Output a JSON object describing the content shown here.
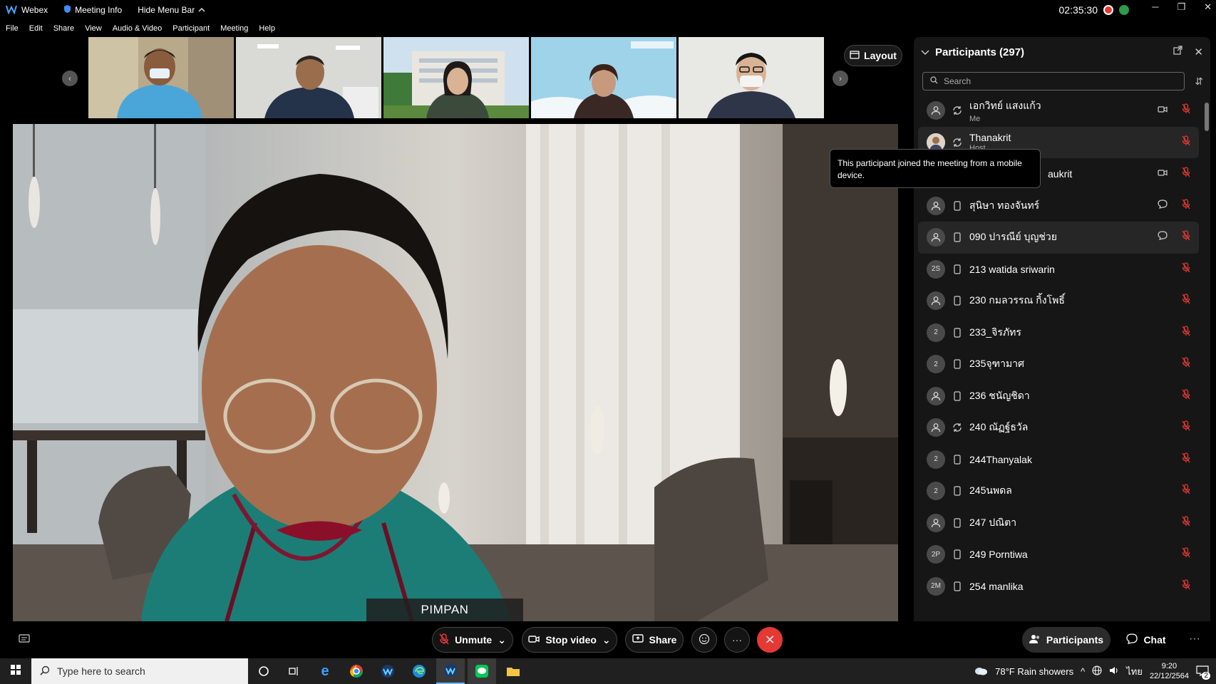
{
  "titlebar": {
    "app_name": "Webex",
    "meeting_info": "Meeting Info",
    "hide_menu": "Hide Menu Bar",
    "clock": "02:35:30"
  },
  "menu": [
    "File",
    "Edit",
    "Share",
    "View",
    "Audio & Video",
    "Participant",
    "Meeting",
    "Help"
  ],
  "layout_label": "Layout",
  "speaker_name": "PIMPAN",
  "panel": {
    "title": "Participants (297)",
    "search_placeholder": "Search"
  },
  "participants": [
    {
      "name": "เอกวิทย์ แสงแก้ว",
      "sub": "Me",
      "avatar": "",
      "device": "sync",
      "video": true,
      "chat": false,
      "hl": false
    },
    {
      "name": "Thanakrit",
      "sub": "Host",
      "avatar": "photo",
      "device": "sync",
      "video": false,
      "chat": false,
      "hl": true
    },
    {
      "name": "aukrit",
      "sub": "",
      "avatar": "",
      "device": "mobile",
      "video": true,
      "chat": false,
      "hl": false
    },
    {
      "name": "สุนิษา ทองจันทร์",
      "sub": "",
      "avatar": "",
      "device": "mobile",
      "video": false,
      "chat": true,
      "hl": false
    },
    {
      "name": "090 ปารณีย์ บุญช่วย",
      "sub": "",
      "avatar": "",
      "device": "mobile",
      "video": false,
      "chat": true,
      "hl": true
    },
    {
      "name": "213 watida sriwarin",
      "sub": "",
      "avatar": "2S",
      "device": "mobile",
      "video": false,
      "chat": false,
      "hl": false
    },
    {
      "name": "230 กมลวรรณ กิ้งโพธิ์",
      "sub": "",
      "avatar": "",
      "device": "mobile",
      "video": false,
      "chat": false,
      "hl": false
    },
    {
      "name": "233_จิรภัทร",
      "sub": "",
      "avatar": "2",
      "device": "mobile",
      "video": false,
      "chat": false,
      "hl": false
    },
    {
      "name": "235จุฑามาศ",
      "sub": "",
      "avatar": "2",
      "device": "mobile",
      "video": false,
      "chat": false,
      "hl": false
    },
    {
      "name": "236 ชนัญชิดา",
      "sub": "",
      "avatar": "",
      "device": "mobile",
      "video": false,
      "chat": false,
      "hl": false
    },
    {
      "name": "240 ณัฏฐ์ธวัล",
      "sub": "",
      "avatar": "",
      "device": "sync",
      "video": false,
      "chat": false,
      "hl": false
    },
    {
      "name": "244Thanyalak",
      "sub": "",
      "avatar": "2",
      "device": "mobile",
      "video": false,
      "chat": false,
      "hl": false
    },
    {
      "name": "245นพดล",
      "sub": "",
      "avatar": "2",
      "device": "mobile",
      "video": false,
      "chat": false,
      "hl": false
    },
    {
      "name": "247 ปณิตา",
      "sub": "",
      "avatar": "",
      "device": "mobile",
      "video": false,
      "chat": false,
      "hl": false
    },
    {
      "name": "249 Porntiwa",
      "sub": "",
      "avatar": "2P",
      "device": "mobile",
      "video": false,
      "chat": false,
      "hl": false
    },
    {
      "name": "254 manlika",
      "sub": "",
      "avatar": "2M",
      "device": "mobile",
      "video": false,
      "chat": false,
      "hl": false
    }
  ],
  "tooltip": "This participant joined the meeting from a mobile device.",
  "controls": {
    "unmute": "Unmute",
    "stop_video": "Stop video",
    "share": "Share",
    "participants": "Participants",
    "chat": "Chat"
  },
  "taskbar": {
    "search_placeholder": "Type here to search",
    "weather": "78°F  Rain showers",
    "lang": "ไทย",
    "time": "9:20",
    "date": "22/12/2564",
    "notif_count": "2"
  },
  "colors": {
    "end_call": "#e53935",
    "mute_red": "#e53935",
    "panel_bg": "#161616"
  }
}
